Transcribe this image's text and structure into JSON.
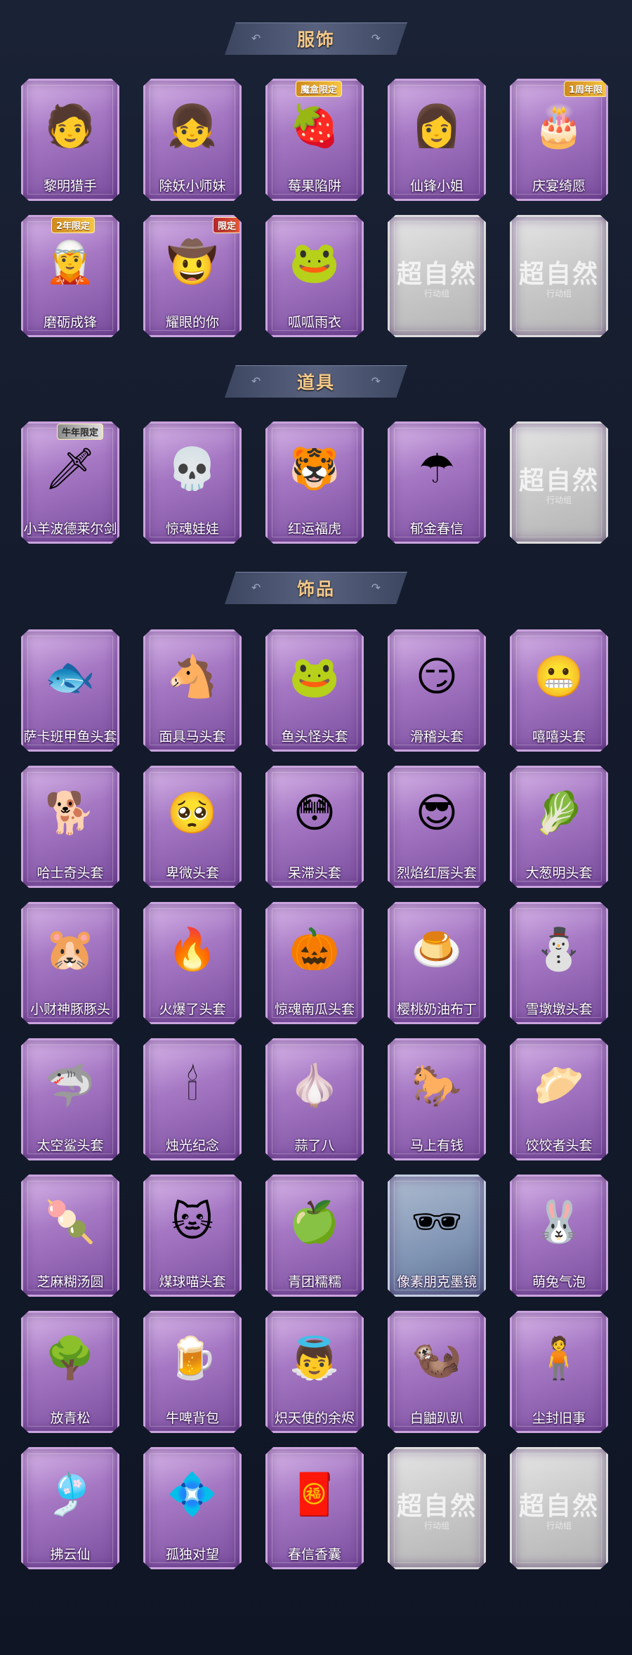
{
  "sections": [
    {
      "title": "服饰",
      "items": [
        {
          "name": "黎明猎手",
          "icon": "hunter-portrait-icon",
          "glyph": "🧑"
        },
        {
          "name": "除妖小师妹",
          "icon": "exorcist-girl-portrait-icon",
          "glyph": "👧"
        },
        {
          "name": "莓果陷阱",
          "icon": "berry-trap-portrait-icon",
          "glyph": "🍓",
          "badge": "魔盒限定"
        },
        {
          "name": "仙锋小姐",
          "icon": "lady-portrait-icon",
          "glyph": "👩"
        },
        {
          "name": "庆宴绮愿",
          "icon": "banquet-portrait-icon",
          "glyph": "🎂",
          "badge": "1周年限"
        },
        {
          "name": "磨砺成锋",
          "icon": "swordsman-portrait-icon",
          "glyph": "🧝",
          "badge": "2年限定"
        },
        {
          "name": "耀眼的你",
          "icon": "cowgirl-portrait-icon",
          "glyph": "🤠",
          "badge": "限定"
        },
        {
          "name": "呱呱雨衣",
          "icon": "frog-raincoat-portrait-icon",
          "glyph": "🐸"
        },
        {
          "name": "",
          "placeholder": "超自然",
          "sub": "行动组",
          "icon": "empty-slot-icon"
        },
        {
          "name": "",
          "placeholder": "超自然",
          "sub": "行动组",
          "icon": "empty-slot-icon"
        }
      ]
    },
    {
      "title": "道具",
      "items": [
        {
          "name": "小羊波德莱尔剑",
          "icon": "sword-icon",
          "glyph": "🗡",
          "badge": "牛年限定"
        },
        {
          "name": "惊魂娃娃",
          "icon": "skull-doll-icon",
          "glyph": "💀"
        },
        {
          "name": "红运福虎",
          "icon": "tiger-icon",
          "glyph": "🐯"
        },
        {
          "name": "郁金春信",
          "icon": "umbrella-icon",
          "glyph": "☂"
        },
        {
          "name": "",
          "placeholder": "超自然",
          "sub": "行动组",
          "icon": "empty-slot-icon"
        }
      ]
    },
    {
      "title": "饰品",
      "items": [
        {
          "name": "萨卡班甲鱼头套",
          "icon": "fish-head-icon",
          "glyph": "🐟"
        },
        {
          "name": "面具马头套",
          "icon": "horse-head-icon",
          "glyph": "🐴"
        },
        {
          "name": "鱼头怪头套",
          "icon": "fish-monster-head-icon",
          "glyph": "🐸"
        },
        {
          "name": "滑稽头套",
          "icon": "funny-face-icon",
          "glyph": "😏"
        },
        {
          "name": "嘻嘻头套",
          "icon": "grin-face-icon",
          "glyph": "😬"
        },
        {
          "name": "哈士奇头套",
          "icon": "husky-head-icon",
          "glyph": "🐕"
        },
        {
          "name": "卑微头套",
          "icon": "humble-face-icon",
          "glyph": "🥺"
        },
        {
          "name": "呆滞头套",
          "icon": "dazed-face-icon",
          "glyph": "😳"
        },
        {
          "name": "烈焰红唇头套",
          "icon": "red-lips-head-icon",
          "glyph": "😎"
        },
        {
          "name": "大葱明头套",
          "icon": "scallion-head-icon",
          "glyph": "🥬"
        },
        {
          "name": "小财神豚豚头",
          "icon": "capybara-head-icon",
          "glyph": "🐹"
        },
        {
          "name": "火爆了头套",
          "icon": "fire-head-icon",
          "glyph": "🔥"
        },
        {
          "name": "惊魂南瓜头套",
          "icon": "pumpkin-head-icon",
          "glyph": "🎃"
        },
        {
          "name": "樱桃奶油布丁",
          "icon": "pudding-head-icon",
          "glyph": "🍮"
        },
        {
          "name": "雪墩墩头套",
          "icon": "snowman-head-icon",
          "glyph": "⛄"
        },
        {
          "name": "太空鲨头套",
          "icon": "space-shark-head-icon",
          "glyph": "🦈"
        },
        {
          "name": "烛光纪念",
          "icon": "candle-icon",
          "glyph": "🕯"
        },
        {
          "name": "蒜了八",
          "icon": "garlic-icon",
          "glyph": "🧄"
        },
        {
          "name": "马上有钱",
          "icon": "horse-money-icon",
          "glyph": "🐎"
        },
        {
          "name": "饺饺者头套",
          "icon": "dumpling-head-icon",
          "glyph": "🥟"
        },
        {
          "name": "芝麻糊汤圆",
          "icon": "tangyuan-icon",
          "glyph": "🍡"
        },
        {
          "name": "煤球喵头套",
          "icon": "black-cat-head-icon",
          "glyph": "🐱"
        },
        {
          "name": "青团糯糯",
          "icon": "green-rice-ball-icon",
          "glyph": "🍏"
        },
        {
          "name": "像素朋克墨镜",
          "icon": "pixel-sunglasses-icon",
          "glyph": "🕶",
          "pixel": true
        },
        {
          "name": "萌兔气泡",
          "icon": "bunny-bubble-icon",
          "glyph": "🐰"
        },
        {
          "name": "放青松",
          "icon": "pine-bonsai-icon",
          "glyph": "🌳"
        },
        {
          "name": "牛啤背包",
          "icon": "beer-backpack-icon",
          "glyph": "🍺"
        },
        {
          "name": "炽天使的余烬",
          "icon": "seraph-figure-icon",
          "glyph": "👼"
        },
        {
          "name": "白鼬趴趴",
          "icon": "ermine-plush-icon",
          "glyph": "🦦"
        },
        {
          "name": "尘封旧事",
          "icon": "figure-charm-icon",
          "glyph": "🧍"
        },
        {
          "name": "拂云仙",
          "icon": "cloud-fairy-charm-icon",
          "glyph": "🎐"
        },
        {
          "name": "孤独对望",
          "icon": "lonely-gaze-charm-icon",
          "glyph": "💠"
        },
        {
          "name": "春信香囊",
          "icon": "sachet-icon",
          "glyph": "🧧"
        },
        {
          "name": "",
          "placeholder": "超自然",
          "sub": "行动组",
          "icon": "empty-slot-icon"
        },
        {
          "name": "",
          "placeholder": "超自然",
          "sub": "行动组",
          "icon": "empty-slot-icon"
        }
      ]
    }
  ]
}
